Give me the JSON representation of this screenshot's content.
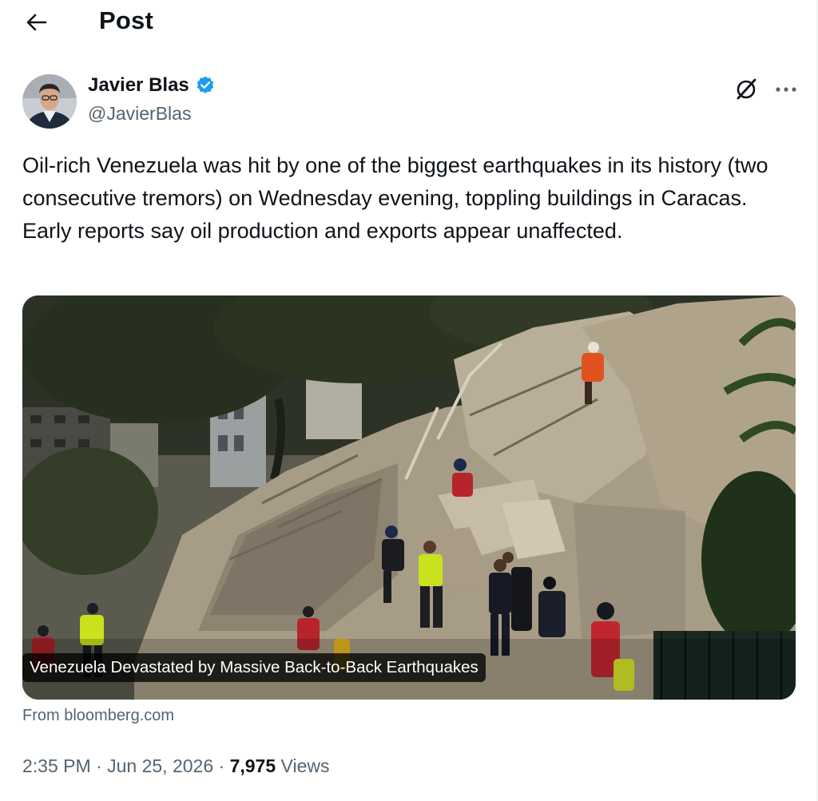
{
  "header": {
    "back_icon": "arrow-left-icon",
    "title": "Post"
  },
  "author": {
    "name": "Javier Blas",
    "handle": "@JavierBlas",
    "verified": true,
    "verified_icon": "verified-badge-icon",
    "verified_color": "#1d9bf0"
  },
  "actions": {
    "grok_icon": "grok-icon",
    "more_icon": "more-horizontal-icon"
  },
  "tweet": {
    "text": "Oil-rich Venezuela was hit by one of the biggest earthquakes in its history (two consecutive tremors) on Wednesday evening, toppling buildings in Caracas. Early reports say oil production and exports appear unaffected."
  },
  "card": {
    "headline": "Venezuela Devastated by Massive Back-to-Back Earthquakes",
    "source": "From bloomberg.com"
  },
  "meta": {
    "time": "2:35 PM",
    "separator": " · ",
    "date": "Jun 25, 2026",
    "views_count": "7,975",
    "views_label": "Views"
  },
  "colors": {
    "text_primary": "#0f1419",
    "text_secondary": "#536471",
    "accent": "#1d9bf0"
  }
}
